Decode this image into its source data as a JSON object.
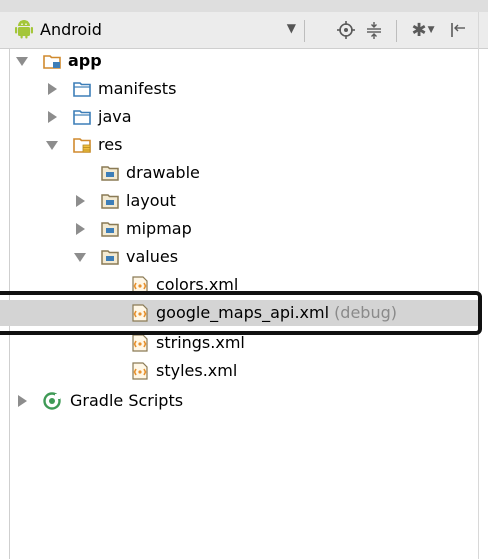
{
  "toolbar": {
    "view_label": "Android",
    "icons": [
      "android-icon",
      "chevron-down-icon",
      "locate-icon",
      "collapse-all-icon",
      "gear-icon",
      "hide-panel-icon"
    ]
  },
  "tree": {
    "app": "app",
    "manifests": "manifests",
    "java": "java",
    "res": "res",
    "drawable": "drawable",
    "layout": "layout",
    "mipmap": "mipmap",
    "values": "values",
    "colors": "colors.xml",
    "google_maps_api": "google_maps_api.xml",
    "google_maps_api_suffix": "(debug)",
    "strings": "strings.xml",
    "styles": "styles.xml",
    "gradle_scripts": "Gradle Scripts"
  },
  "colors": {
    "folder_blue": "#3d7eb8",
    "android_green": "#a4c639",
    "xml_orange": "#e8912d",
    "gradle_green": "#3f9a56"
  }
}
